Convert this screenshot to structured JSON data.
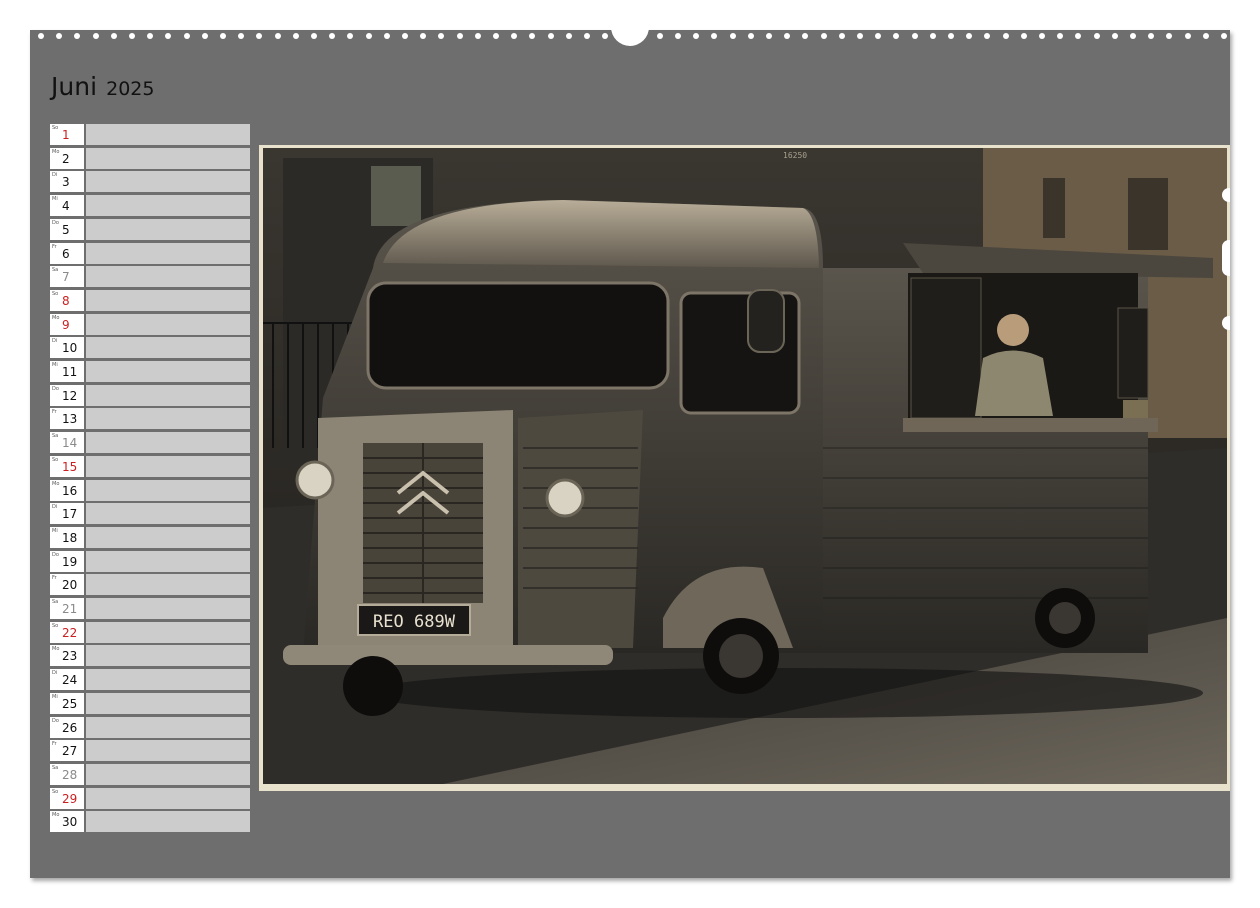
{
  "header": {
    "month": "Juni",
    "year": "2025"
  },
  "days": [
    {
      "wd": "So",
      "day": "1",
      "type": "sun"
    },
    {
      "wd": "Mo",
      "day": "2",
      "type": "wk"
    },
    {
      "wd": "Di",
      "day": "3",
      "type": "wk"
    },
    {
      "wd": "Mi",
      "day": "4",
      "type": "wk"
    },
    {
      "wd": "Do",
      "day": "5",
      "type": "wk"
    },
    {
      "wd": "Fr",
      "day": "6",
      "type": "wk"
    },
    {
      "wd": "Sa",
      "day": "7",
      "type": "sat"
    },
    {
      "wd": "So",
      "day": "8",
      "type": "sun"
    },
    {
      "wd": "Mo",
      "day": "9",
      "type": "sun"
    },
    {
      "wd": "Di",
      "day": "10",
      "type": "wk"
    },
    {
      "wd": "Mi",
      "day": "11",
      "type": "wk"
    },
    {
      "wd": "Do",
      "day": "12",
      "type": "wk"
    },
    {
      "wd": "Fr",
      "day": "13",
      "type": "wk"
    },
    {
      "wd": "Sa",
      "day": "14",
      "type": "sat"
    },
    {
      "wd": "So",
      "day": "15",
      "type": "sun"
    },
    {
      "wd": "Mo",
      "day": "16",
      "type": "wk"
    },
    {
      "wd": "Di",
      "day": "17",
      "type": "wk"
    },
    {
      "wd": "Mi",
      "day": "18",
      "type": "wk"
    },
    {
      "wd": "Do",
      "day": "19",
      "type": "wk"
    },
    {
      "wd": "Fr",
      "day": "20",
      "type": "wk"
    },
    {
      "wd": "Sa",
      "day": "21",
      "type": "sat"
    },
    {
      "wd": "So",
      "day": "22",
      "type": "sun"
    },
    {
      "wd": "Mo",
      "day": "23",
      "type": "wk"
    },
    {
      "wd": "Di",
      "day": "24",
      "type": "wk"
    },
    {
      "wd": "Mi",
      "day": "25",
      "type": "wk"
    },
    {
      "wd": "Do",
      "day": "26",
      "type": "wk"
    },
    {
      "wd": "Fr",
      "day": "27",
      "type": "wk"
    },
    {
      "wd": "Sa",
      "day": "28",
      "type": "sat"
    },
    {
      "wd": "So",
      "day": "29",
      "type": "sun"
    },
    {
      "wd": "Mo",
      "day": "30",
      "type": "wk"
    }
  ],
  "photo": {
    "plate": "REO 689W",
    "film_code": "16250"
  },
  "colors": {
    "sunday": "#cc1f1f",
    "saturday": "#8a8a8a",
    "weekday": "#111111"
  }
}
